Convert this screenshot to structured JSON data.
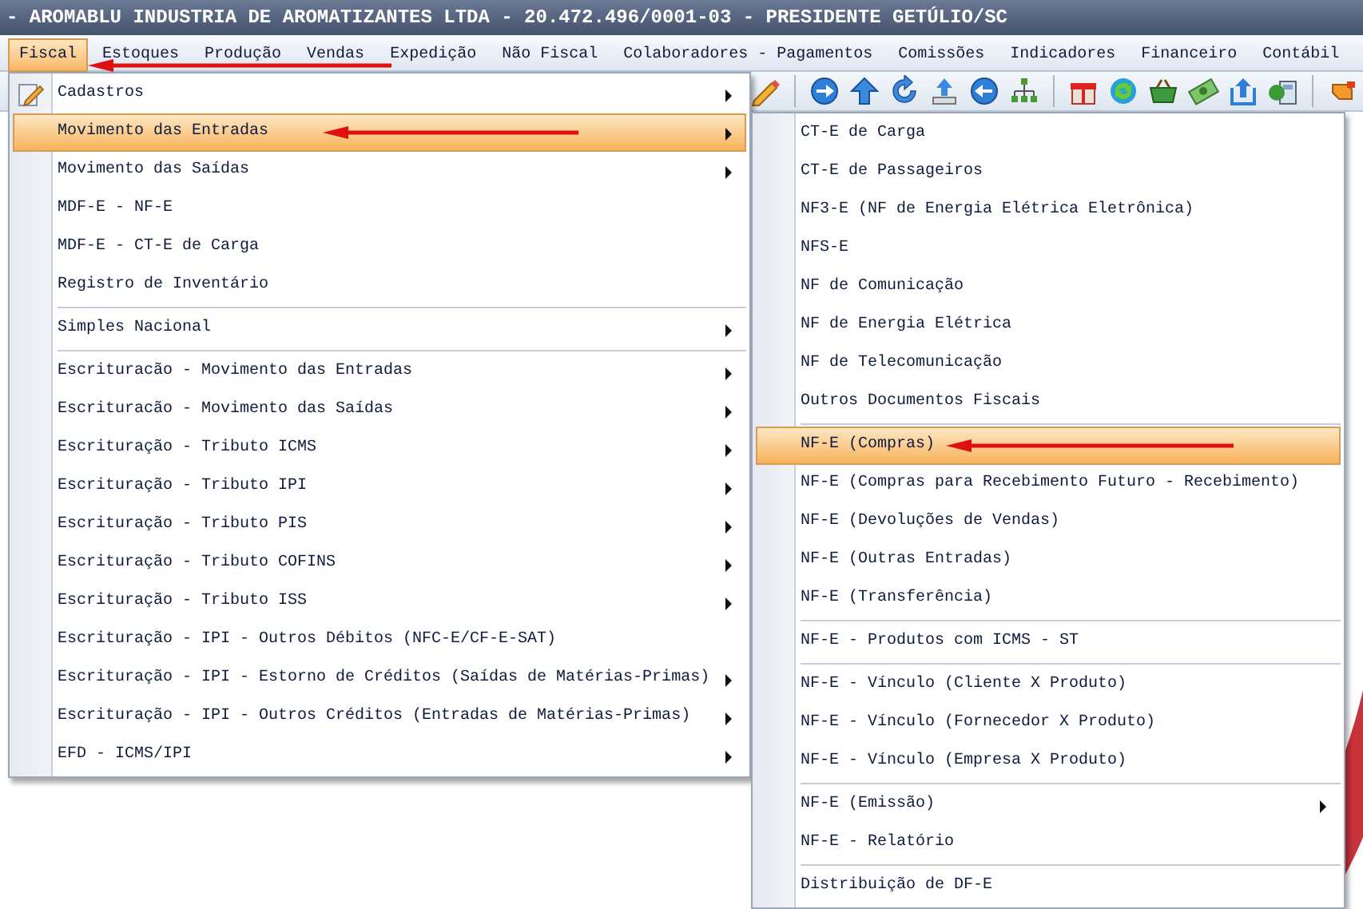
{
  "window": {
    "title": "- AROMABLU INDUSTRIA DE AROMATIZANTES LTDA - 20.472.496/0001-03 - PRESIDENTE GETÚLIO/SC"
  },
  "menubar": [
    {
      "label": "Fiscal",
      "selected": true,
      "marked": true
    },
    {
      "label": "Estoques",
      "selected": false,
      "marked": false
    },
    {
      "label": "Produção",
      "selected": false,
      "marked": false
    },
    {
      "label": "Vendas",
      "selected": false,
      "marked": false
    },
    {
      "label": "Expedição",
      "selected": false,
      "marked": false
    },
    {
      "label": "Não Fiscal",
      "selected": false,
      "marked": false
    },
    {
      "label": "Colaboradores - Pagamentos",
      "selected": false,
      "marked": false
    },
    {
      "label": "Comissões",
      "selected": false,
      "marked": false
    },
    {
      "label": "Indicadores",
      "selected": false,
      "marked": false
    },
    {
      "label": "Financeiro",
      "selected": false,
      "marked": false
    },
    {
      "label": "Contábil",
      "selected": false,
      "marked": false
    }
  ],
  "menu": [
    {
      "kind": "item",
      "label": "Cadastros",
      "has_icon": true,
      "has_submenu": true,
      "selected": false,
      "marked": false
    },
    {
      "kind": "item",
      "label": "Movimento das Entradas",
      "has_icon": false,
      "has_submenu": true,
      "selected": true,
      "marked": true
    },
    {
      "kind": "item",
      "label": "Movimento das Saídas",
      "has_icon": false,
      "has_submenu": true,
      "selected": false,
      "marked": false
    },
    {
      "kind": "item",
      "label": "MDF-E - NF-E",
      "has_icon": false,
      "has_submenu": false,
      "selected": false,
      "marked": false
    },
    {
      "kind": "item",
      "label": "MDF-E - CT-E de Carga",
      "has_icon": false,
      "has_submenu": false,
      "selected": false,
      "marked": false
    },
    {
      "kind": "item",
      "label": "Registro de Inventário",
      "has_icon": false,
      "has_submenu": false,
      "selected": false,
      "marked": false
    },
    {
      "kind": "separator"
    },
    {
      "kind": "item",
      "label": "Simples Nacional",
      "has_icon": false,
      "has_submenu": true,
      "selected": false,
      "marked": false
    },
    {
      "kind": "separator"
    },
    {
      "kind": "item",
      "label": "Escrituracão - Movimento das Entradas",
      "has_icon": false,
      "has_submenu": true,
      "selected": false,
      "marked": false
    },
    {
      "kind": "item",
      "label": "Escrituracão - Movimento das Saídas",
      "has_icon": false,
      "has_submenu": true,
      "selected": false,
      "marked": false
    },
    {
      "kind": "item",
      "label": "Escrituração - Tributo ICMS",
      "has_icon": false,
      "has_submenu": true,
      "selected": false,
      "marked": false
    },
    {
      "kind": "item",
      "label": "Escrituração - Tributo IPI",
      "has_icon": false,
      "has_submenu": true,
      "selected": false,
      "marked": false
    },
    {
      "kind": "item",
      "label": "Escrituração - Tributo PIS",
      "has_icon": false,
      "has_submenu": true,
      "selected": false,
      "marked": false
    },
    {
      "kind": "item",
      "label": "Escrituração - Tributo COFINS",
      "has_icon": false,
      "has_submenu": true,
      "selected": false,
      "marked": false
    },
    {
      "kind": "item",
      "label": "Escrituração - Tributo ISS",
      "has_icon": false,
      "has_submenu": true,
      "selected": false,
      "marked": false
    },
    {
      "kind": "item",
      "label": "Escrituração - IPI - Outros Débitos (NFC-E/CF-E-SAT)",
      "has_icon": false,
      "has_submenu": false,
      "selected": false,
      "marked": false
    },
    {
      "kind": "item",
      "label": "Escrituração - IPI - Estorno de Créditos (Saídas de Matérias-Primas)",
      "has_icon": false,
      "has_submenu": true,
      "selected": false,
      "marked": false
    },
    {
      "kind": "item",
      "label": "Escrituração - IPI - Outros Créditos (Entradas de Matérias-Primas)",
      "has_icon": false,
      "has_submenu": true,
      "selected": false,
      "marked": false
    },
    {
      "kind": "item",
      "label": "EFD - ICMS/IPI",
      "has_icon": false,
      "has_submenu": true,
      "selected": false,
      "marked": false
    }
  ],
  "submenu": [
    {
      "kind": "item",
      "label": "CT-E de Carga",
      "has_submenu": false,
      "selected": false,
      "marked": false
    },
    {
      "kind": "item",
      "label": "CT-E de Passageiros",
      "has_submenu": false,
      "selected": false,
      "marked": false
    },
    {
      "kind": "item",
      "label": "NF3-E (NF de Energia Elétrica Eletrônica)",
      "has_submenu": false,
      "selected": false,
      "marked": false
    },
    {
      "kind": "item",
      "label": "NFS-E",
      "has_submenu": false,
      "selected": false,
      "marked": false
    },
    {
      "kind": "item",
      "label": "NF de Comunicação",
      "has_submenu": false,
      "selected": false,
      "marked": false
    },
    {
      "kind": "item",
      "label": "NF de Energia Elétrica",
      "has_submenu": false,
      "selected": false,
      "marked": false
    },
    {
      "kind": "item",
      "label": "NF de Telecomunicação",
      "has_submenu": false,
      "selected": false,
      "marked": false
    },
    {
      "kind": "item",
      "label": "Outros Documentos Fiscais",
      "has_submenu": false,
      "selected": false,
      "marked": false
    },
    {
      "kind": "separator"
    },
    {
      "kind": "item",
      "label": "NF-E (Compras)",
      "has_submenu": false,
      "selected": true,
      "marked": true
    },
    {
      "kind": "item",
      "label": "NF-E (Compras para Recebimento Futuro - Recebimento)",
      "has_submenu": false,
      "selected": false,
      "marked": false
    },
    {
      "kind": "item",
      "label": "NF-E (Devoluções de Vendas)",
      "has_submenu": false,
      "selected": false,
      "marked": false
    },
    {
      "kind": "item",
      "label": "NF-E (Outras Entradas)",
      "has_submenu": false,
      "selected": false,
      "marked": false
    },
    {
      "kind": "item",
      "label": "NF-E (Transferência)",
      "has_submenu": false,
      "selected": false,
      "marked": false
    },
    {
      "kind": "separator"
    },
    {
      "kind": "item",
      "label": "NF-E - Produtos com ICMS - ST",
      "has_submenu": false,
      "selected": false,
      "marked": false
    },
    {
      "kind": "separator"
    },
    {
      "kind": "item",
      "label": "NF-E - Vínculo (Cliente X Produto)",
      "has_submenu": false,
      "selected": false,
      "marked": false
    },
    {
      "kind": "item",
      "label": "NF-E - Vínculo (Fornecedor X Produto)",
      "has_submenu": false,
      "selected": false,
      "marked": false
    },
    {
      "kind": "item",
      "label": "NF-E - Vínculo (Empresa X Produto)",
      "has_submenu": false,
      "selected": false,
      "marked": false
    },
    {
      "kind": "separator"
    },
    {
      "kind": "item",
      "label": "NF-E (Emissão)",
      "has_submenu": true,
      "selected": false,
      "marked": false
    },
    {
      "kind": "item",
      "label": "NF-E - Relatório",
      "has_submenu": false,
      "selected": false,
      "marked": false
    },
    {
      "kind": "separator"
    },
    {
      "kind": "item",
      "label": "Distribuição de DF-E",
      "has_submenu": false,
      "selected": false,
      "marked": false
    }
  ]
}
